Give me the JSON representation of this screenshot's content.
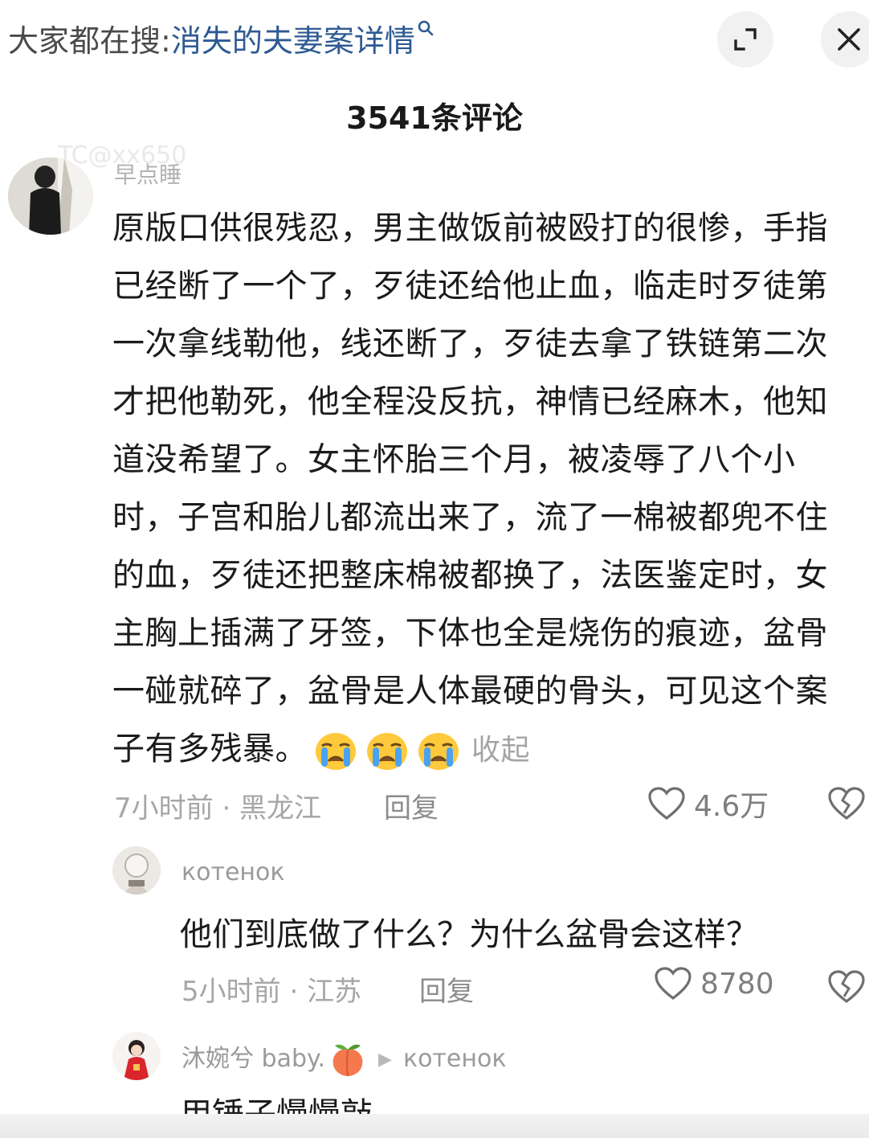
{
  "header": {
    "search_prefix": "大家都在搜:",
    "search_term": "消失的夫妻案详情",
    "expand_icon": "expand-icon",
    "close_icon": "close-icon"
  },
  "comment_count": "3541条评论",
  "watermark": "TC@xx650",
  "comments": [
    {
      "username": "早点睡",
      "text": "原版口供很残忍，男主做饭前被殴打的很惨，手指已经断了一个了，歹徒还给他止血，临走时歹徒第一次拿线勒他，线还断了，歹徒去拿了铁链第二次才把他勒死，他全程没反抗，神情已经麻木，他知道没希望了。女主怀胎三个月，被凌辱了八个小时，子宫和胎儿都流出来了，流了一棉被都兜不住的血，歹徒还把整床棉被都换了，法医鉴定时，女主胸上插满了牙签，下体也全是烧伤的痕迹，盆骨一碰就碎了，盆骨是人体最硬的骨头，可见这个案子有多残暴。",
      "emojis": [
        "crying-face",
        "crying-face",
        "crying-face"
      ],
      "collapse_label": "收起",
      "meta": "7小时前 · 黑龙江",
      "reply_label": "回复",
      "likes": "4.6万"
    }
  ],
  "replies": [
    {
      "username": "котенок",
      "text": "他们到底做了什么？为什么盆骨会这样？",
      "meta": "5小时前 · 江苏",
      "reply_label": "回复",
      "likes": "8780"
    },
    {
      "username": "沐婉兮 baby.",
      "reply_to": "котенок",
      "text": "用锤子慢慢敲"
    }
  ],
  "colors": {
    "search_term": "#2e5a93",
    "text": "#1b1b1b",
    "muted": "#a6a6a6",
    "button_bg": "#f1f1f1"
  }
}
